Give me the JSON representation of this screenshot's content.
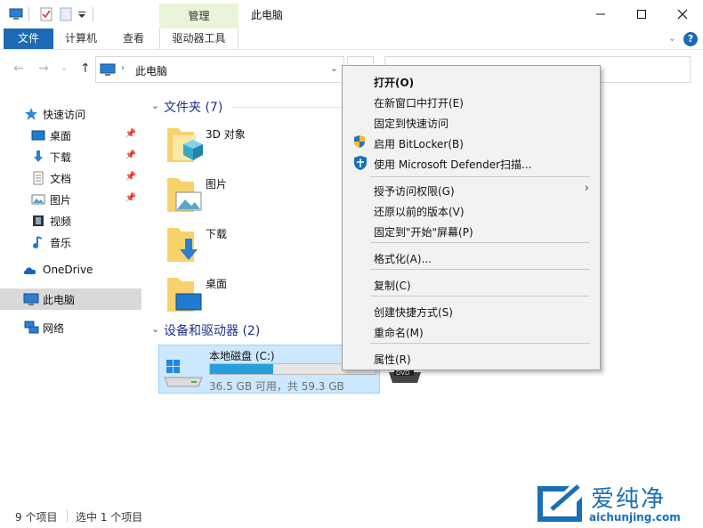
{
  "window": {
    "title": "此电脑",
    "context_tab": "管理"
  },
  "ribbon": {
    "tabs": [
      "文件",
      "计算机",
      "查看",
      "驱动器工具"
    ]
  },
  "address": {
    "path": "此电脑"
  },
  "nav": {
    "quick_access": "快速访问",
    "items": [
      "桌面",
      "下载",
      "文档",
      "图片",
      "视频",
      "音乐"
    ],
    "onedrive": "OneDrive",
    "this_pc": "此电脑",
    "network": "网络"
  },
  "content": {
    "folders_header": "文件夹 (7)",
    "folders": [
      "3D 对象",
      "图片",
      "下载",
      "桌面"
    ],
    "devices_header": "设备和驱动器 (2)",
    "drive": {
      "name": "本地磁盘 (C:)",
      "free_text": "36.5 GB 可用，共 59.3 GB",
      "used_fraction": 0.38
    },
    "dvd_label": "DVD"
  },
  "status": {
    "count": "9 个项目",
    "selected": "选中 1 个项目"
  },
  "context_menu": {
    "open": "打开(O)",
    "open_new_window": "在新窗口中打开(E)",
    "pin_quick": "固定到快速访问",
    "bitlocker": "启用 BitLocker(B)",
    "defender": "使用 Microsoft Defender扫描...",
    "grant_access": "授予访问权限(G)",
    "restore": "还原以前的版本(V)",
    "pin_start": "固定到\"开始\"屏幕(P)",
    "format": "格式化(A)...",
    "copy": "复制(C)",
    "create_shortcut": "创建快捷方式(S)",
    "rename": "重命名(M)",
    "properties": "属性(R)"
  },
  "watermark": {
    "title": "爱纯净",
    "url": "aichunjing.com"
  },
  "colors": {
    "accent": "#1d69b6",
    "manage_tab": "#e9f5d8",
    "selection": "#cce8ff",
    "drive_bar": "#26a0da"
  }
}
